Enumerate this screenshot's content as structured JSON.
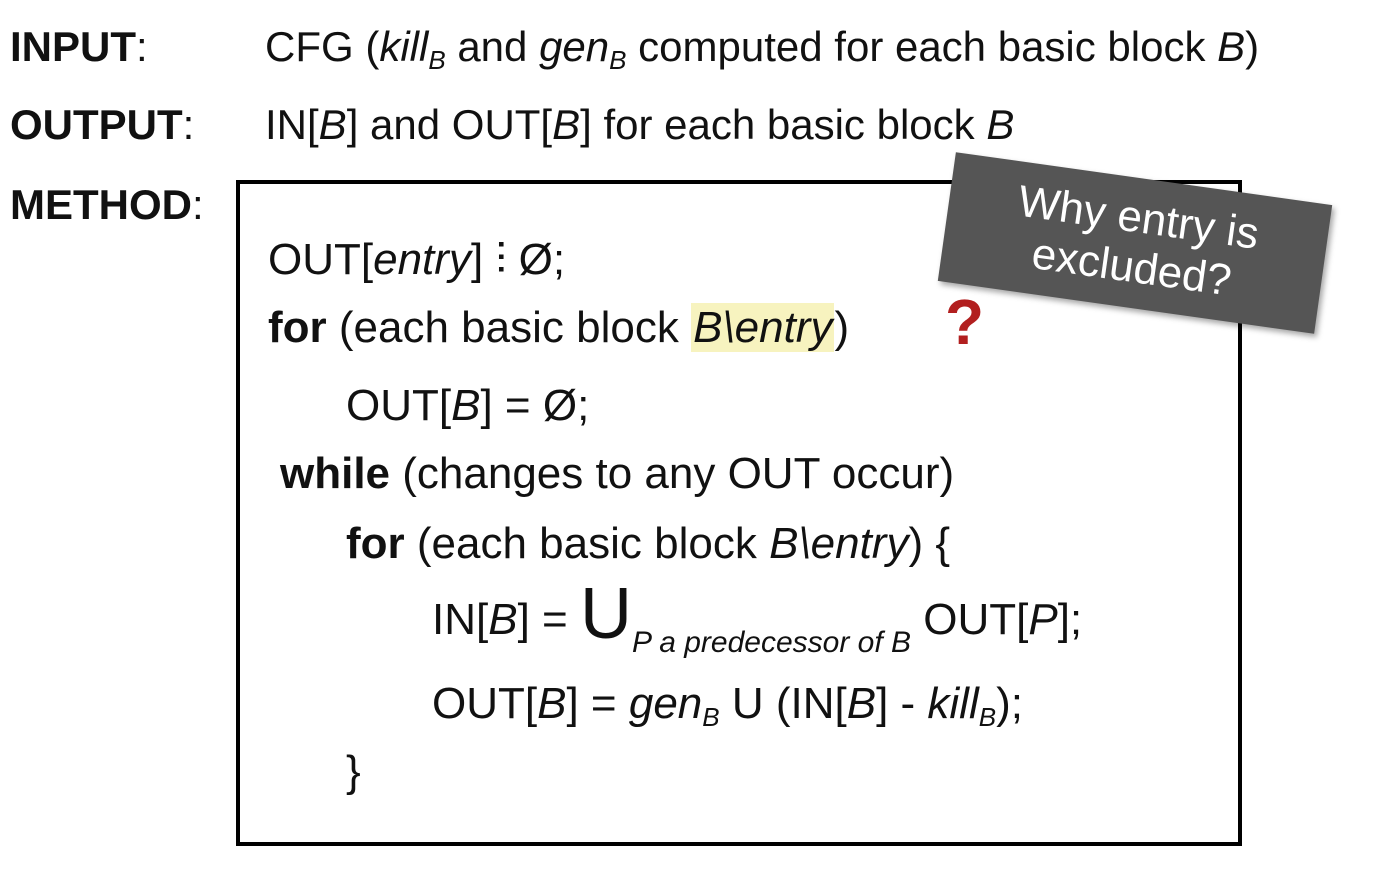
{
  "header": {
    "input_label": "INPUT",
    "output_label": "OUTPUT",
    "method_label": "METHOD",
    "colon": ":"
  },
  "input": {
    "prefix": "CFG (",
    "kill": "kill",
    "sub_b": "B",
    "and": " and ",
    "gen": "gen",
    "rest": " computed for each basic block ",
    "block": "B",
    "close": ")"
  },
  "output": {
    "in_open": "IN[",
    "block": "B",
    "and_out": "] and OUT[",
    "rest": "] for each basic block "
  },
  "code": {
    "line1_a": "OUT[",
    "entry": "entry",
    "line1_b": "] ",
    "line1_glyph": "⫶",
    "line1_c": " Ø;",
    "for_kw": "for",
    "for_text": " (each basic block ",
    "b_entry": "B\\entry",
    "close_paren": ")",
    "qmark": "?",
    "init_a": "OUT[",
    "block": "B",
    "init_b": "] = Ø;",
    "while_kw": "while",
    "while_text": " (changes to any OUT occur)",
    "for2_kw": "for",
    "for2_text": " (each basic block ",
    "for2_close": ") {",
    "in_a": "IN[",
    "in_b": "] = ",
    "union": "U",
    "pred": "P a predecessor of B",
    "in_c": " OUT[",
    "p": "P",
    "in_d": "];",
    "out_a": "OUT[",
    "out_b": "] = ",
    "gen": "gen",
    "sub_b": "B",
    "out_c": " U (IN[",
    "out_d": "] - ",
    "kill": "kill",
    "out_e": ");",
    "brace": "}"
  },
  "note": {
    "text": "Why entry is excluded?"
  }
}
